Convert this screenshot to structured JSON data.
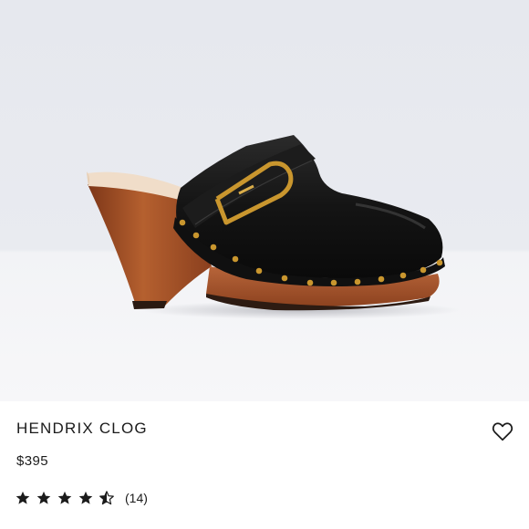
{
  "product": {
    "name": "HENDRIX CLOG",
    "price": "$395",
    "rating": 4.5,
    "rating_max": 5,
    "review_count": "(14)"
  },
  "colors": {
    "text": "#1b1b1b",
    "leather": "#141414",
    "wood": "#9c4a26",
    "gold": "#c9962e",
    "background_upper": "#e6e8ee"
  },
  "icons": {
    "favorite": "heart-outline-icon",
    "star_full": "star-filled-icon",
    "star_half": "star-half-icon"
  }
}
